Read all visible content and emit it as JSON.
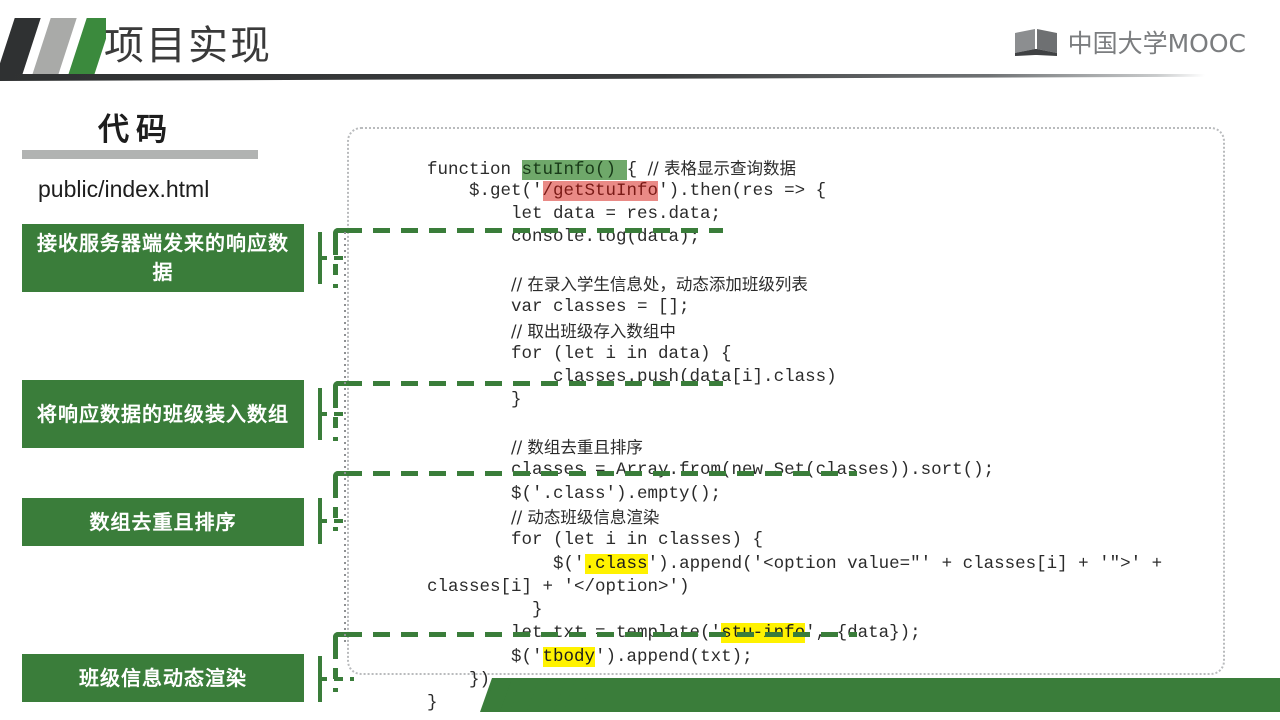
{
  "header": {
    "title": "项目实现",
    "brand_text": "中国大学MOOC",
    "brand_icon": "book-logo-icon"
  },
  "left_panel": {
    "subtitle": "代码",
    "file_path": "public/index.html",
    "accent_color": "#3a7d3a",
    "tags": [
      {
        "label": "接收服务器端发来的响应数据"
      },
      {
        "label": "将响应数据的班级装入数组"
      },
      {
        "label": "数组去重且排序"
      },
      {
        "label": "班级信息动态渲染"
      }
    ]
  },
  "code_panel": {
    "language": "javascript",
    "highlight_colors": {
      "green": "#6fa86a",
      "red": "#e98a86",
      "yellow": "#fff200"
    },
    "lines": [
      {
        "segments": [
          {
            "t": "    function "
          },
          {
            "t": "stuInfo() ",
            "h": "g"
          },
          {
            "t": "{ "
          },
          {
            "t": "// 表格显示查询数据",
            "cn": true
          }
        ]
      },
      {
        "segments": [
          {
            "t": "        $.get('"
          },
          {
            "t": "/getStuInfo",
            "h": "r"
          },
          {
            "t": "').then(res => {"
          }
        ]
      },
      {
        "segments": [
          {
            "t": "            let data = res.data;"
          }
        ]
      },
      {
        "segments": [
          {
            "t": "            console.log(data);"
          }
        ]
      },
      {
        "segments": [
          {
            "t": ""
          }
        ]
      },
      {
        "segments": [
          {
            "t": "            "
          },
          {
            "t": "// 在录入学生信息处，动态添加班级列表",
            "cn": true
          }
        ]
      },
      {
        "segments": [
          {
            "t": "            var classes = [];"
          }
        ]
      },
      {
        "segments": [
          {
            "t": "            "
          },
          {
            "t": "// 取出班级存入数组中",
            "cn": true
          }
        ]
      },
      {
        "segments": [
          {
            "t": "            for (let i in data) {"
          }
        ]
      },
      {
        "segments": [
          {
            "t": "                classes.push(data[i].class)"
          }
        ]
      },
      {
        "segments": [
          {
            "t": "            }"
          }
        ]
      },
      {
        "segments": [
          {
            "t": ""
          }
        ]
      },
      {
        "segments": [
          {
            "t": "            "
          },
          {
            "t": "// 数组去重且排序",
            "cn": true
          }
        ]
      },
      {
        "segments": [
          {
            "t": "            classes = Array.from(new Set(classes)).sort();"
          }
        ]
      },
      {
        "segments": [
          {
            "t": "            $('.class').empty();"
          }
        ]
      },
      {
        "segments": [
          {
            "t": "            "
          },
          {
            "t": "// 动态班级信息渲染",
            "cn": true
          }
        ]
      },
      {
        "segments": [
          {
            "t": "            for (let i in classes) {"
          }
        ]
      },
      {
        "segments": [
          {
            "t": "                $('"
          },
          {
            "t": ".class",
            "h": "y"
          },
          {
            "t": "').append('<option value=\"' + classes[i] + '\">' +"
          }
        ]
      },
      {
        "segments": [
          {
            "t": "    classes[i] + '</option>')"
          }
        ]
      },
      {
        "segments": [
          {
            "t": "              }"
          }
        ]
      },
      {
        "segments": [
          {
            "t": "            let txt = template('"
          },
          {
            "t": "stu-info",
            "h": "y"
          },
          {
            "t": "', {data});"
          }
        ]
      },
      {
        "segments": [
          {
            "t": "            $('"
          },
          {
            "t": "tbody",
            "h": "y"
          },
          {
            "t": "').append(txt);"
          }
        ]
      },
      {
        "segments": [
          {
            "t": "        })"
          }
        ]
      },
      {
        "segments": [
          {
            "t": "    }"
          }
        ]
      }
    ]
  },
  "connectors": [
    {
      "name": "connector-receive-response-data"
    },
    {
      "name": "connector-load-classes-into-array"
    },
    {
      "name": "connector-dedupe-and-sort"
    },
    {
      "name": "connector-render-class-info"
    }
  ]
}
